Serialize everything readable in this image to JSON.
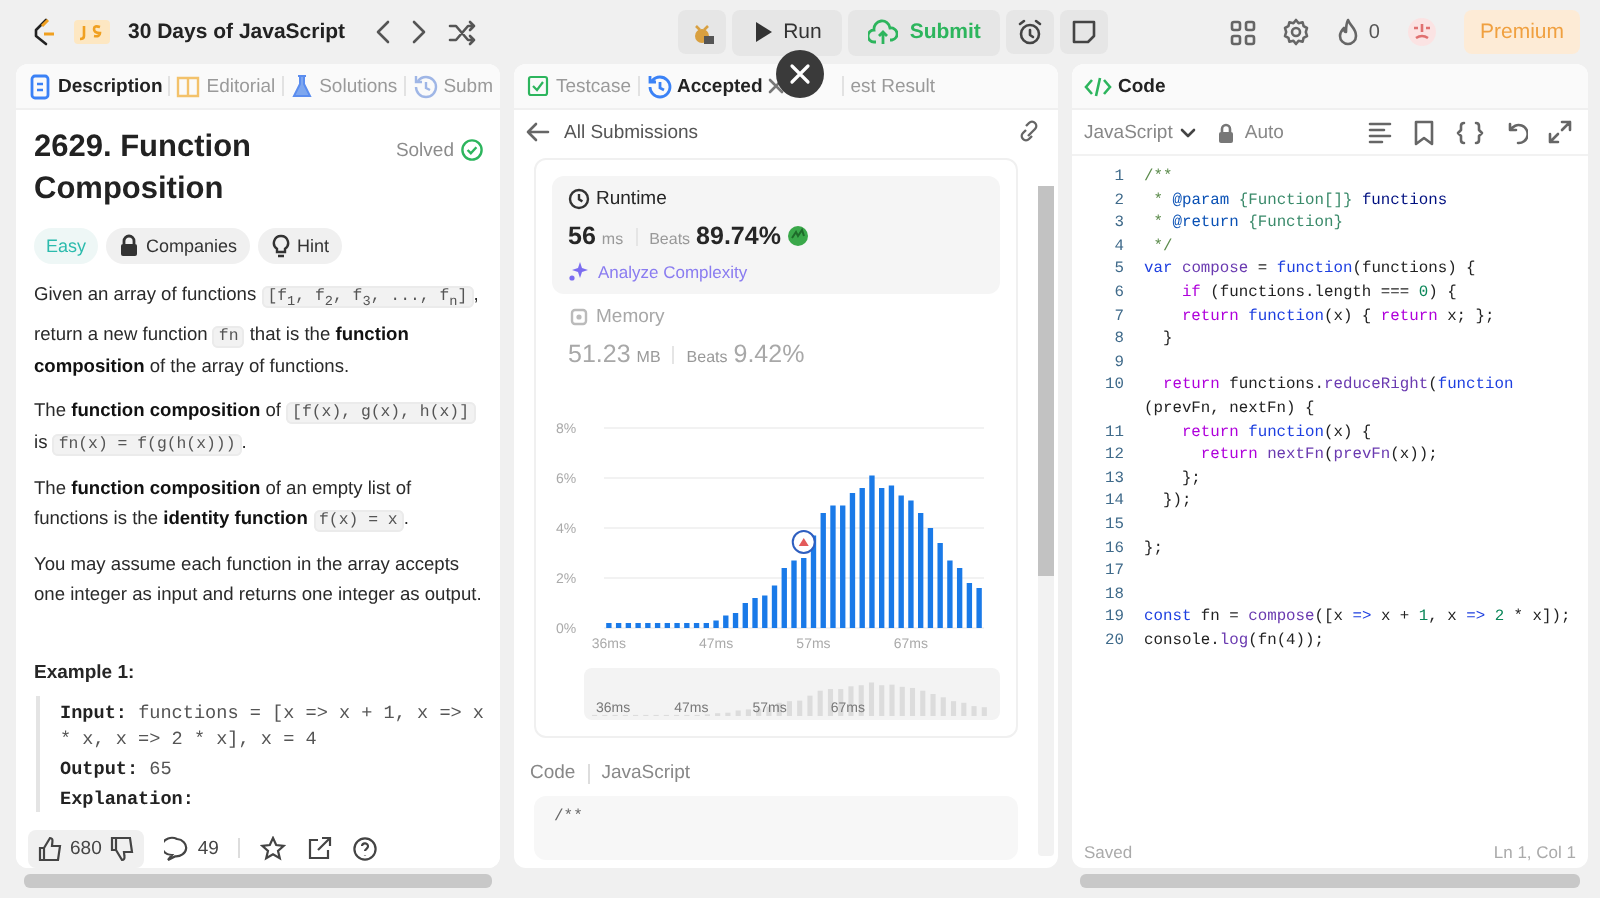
{
  "top_bar": {
    "title": "30 Days of JavaScript",
    "actions": [
      {
        "kind": "run",
        "label": "Run"
      },
      {
        "kind": "submit",
        "label": "Submit"
      }
    ],
    "streak": "0",
    "premium": "Premium"
  },
  "description_panel": {
    "tabs": [
      {
        "label": "Description",
        "selected": true
      },
      {
        "label": "Editorial",
        "selected": false
      },
      {
        "label": "Solutions",
        "selected": false
      },
      {
        "label": "Subm",
        "selected": false
      }
    ],
    "title": "2629. Function Composition",
    "status": "Solved",
    "difficulty": "Easy",
    "tags": [
      "Companies",
      "Hint"
    ],
    "paragraphs": [
      [
        {
          "kind": "text",
          "text": "Given an array of functions "
        },
        {
          "kind": "code",
          "text": "[f$_{1}$, f$_{2}$, f$_{3}$, ..., f$_{n}$]"
        },
        {
          "kind": "text",
          "text": ", return a new function "
        },
        {
          "kind": "code",
          "text": "fn"
        },
        {
          "kind": "text",
          "text": " that is the **function composition** of the array of functions."
        }
      ],
      [
        {
          "kind": "text",
          "text": "The **function composition** of "
        },
        {
          "kind": "code",
          "text": "[f(x), g(x), h(x)]"
        },
        {
          "kind": "text",
          "text": " is "
        },
        {
          "kind": "code",
          "text": "fn(x) = f(g(h(x)))"
        },
        {
          "kind": "text",
          "text": "."
        }
      ],
      [
        {
          "kind": "text",
          "text": "The **function composition** of an empty list of functions is the **identity function** "
        },
        {
          "kind": "code",
          "text": "f(x) = x"
        },
        {
          "kind": "text",
          "text": "."
        }
      ],
      [
        {
          "kind": "text",
          "text": "You may assume each function in the array accepts one integer as input and returns one integer as output."
        }
      ]
    ],
    "example": {
      "heading": "Example 1:",
      "rows": [
        {
          "label": "Input:",
          "value": "functions = [x => x + 1, x => x * x, x => 2 * x], x = 4"
        },
        {
          "label": "Output:",
          "value": "65"
        },
        {
          "label": "Explanation:"
        }
      ]
    },
    "footer": {
      "likes": "680",
      "comments": "49"
    }
  },
  "submission": {
    "tabs": [
      {
        "label": "Testcase",
        "selected": false,
        "closable": false
      },
      {
        "label": "Accepted",
        "selected": true,
        "closable": true
      },
      {
        "label": "est Result",
        "selected": false,
        "closable": false
      }
    ],
    "back_label": "All Submissions",
    "metrics": [
      {
        "title": "Runtime",
        "selected": true,
        "value": "56",
        "unit": "ms",
        "beats_label": "Beats",
        "beats": "89.74%",
        "action": "Analyze Complexity"
      },
      {
        "title": "Memory",
        "selected": false,
        "value": "51.23",
        "unit": "MB",
        "beats_label": "Beats",
        "beats": "9.42%"
      }
    ],
    "chart_data": {
      "type": "bar",
      "x": [
        36,
        37,
        38,
        39,
        40,
        41,
        42,
        43,
        44,
        45,
        46,
        47,
        48,
        49,
        50,
        51,
        52,
        53,
        54,
        55,
        56,
        57,
        58,
        59,
        60,
        61,
        62,
        63,
        64,
        65,
        66,
        67,
        68,
        69,
        70,
        71,
        72,
        73,
        74
      ],
      "values": [
        0.2,
        0.2,
        0.2,
        0.2,
        0.2,
        0.2,
        0.2,
        0.2,
        0.2,
        0.2,
        0.2,
        0.3,
        0.5,
        0.6,
        1.0,
        1.2,
        1.3,
        1.7,
        2.4,
        2.7,
        2.8,
        3.7,
        4.6,
        4.9,
        4.9,
        5.4,
        5.6,
        6.1,
        5.6,
        5.7,
        5.3,
        5.1,
        4.6,
        4.0,
        3.4,
        2.7,
        2.4,
        1.8,
        1.6
      ],
      "xlim": [
        35.5,
        74.5
      ],
      "ylim": [
        0,
        8
      ],
      "grid": true,
      "yticks": [
        {
          "value": 0,
          "label": "0%"
        },
        {
          "value": 2,
          "label": "2%"
        },
        {
          "value": 4,
          "label": "4%"
        },
        {
          "value": 6,
          "label": "6%"
        },
        {
          "value": 8,
          "label": "8%"
        }
      ],
      "xticks": [
        {
          "value": 36,
          "label": "36ms"
        },
        {
          "value": 47,
          "label": "47ms"
        },
        {
          "value": 57,
          "label": "57ms"
        },
        {
          "value": 67,
          "label": "67ms"
        }
      ]
    },
    "overview_labels": [
      "36ms",
      "47ms",
      "57ms",
      "67ms"
    ],
    "code_label": "Code",
    "code_language": "JavaScript",
    "code_preview": "/**"
  },
  "editor": {
    "tab": "Code",
    "language": "JavaScript",
    "mode": "Auto",
    "lines": [
      {
        "number": "1",
        "segments": [
          {
            "kind": "comment",
            "text": "/**"
          }
        ]
      },
      {
        "number": "2",
        "segments": [
          {
            "kind": "comment",
            "text": " * "
          },
          {
            "kind": "tag",
            "text": "@param"
          },
          {
            "kind": "type",
            "text": " {Function[]}"
          },
          {
            "kind": "param",
            "text": " functions"
          }
        ]
      },
      {
        "number": "3",
        "segments": [
          {
            "kind": "comment",
            "text": " * "
          },
          {
            "kind": "tag",
            "text": "@return"
          },
          {
            "kind": "type",
            "text": " {Function}"
          }
        ]
      },
      {
        "number": "4",
        "segments": [
          {
            "kind": "comment",
            "text": " */"
          }
        ]
      },
      {
        "number": "5",
        "segments": [
          {
            "kind": "storage",
            "text": "var "
          },
          {
            "kind": "func",
            "text": "compose"
          },
          {
            "kind": "plain",
            "text": " = "
          },
          {
            "kind": "storage",
            "text": "function"
          },
          {
            "kind": "plain",
            "text": "(functions) {"
          }
        ]
      },
      {
        "number": "6",
        "segments": [
          {
            "kind": "control",
            "text": "    if"
          },
          {
            "kind": "plain",
            "text": " (functions.length === "
          },
          {
            "kind": "number",
            "text": "0"
          },
          {
            "kind": "plain",
            "text": ") {"
          }
        ]
      },
      {
        "number": "7",
        "segments": [
          {
            "kind": "control",
            "text": "    return "
          },
          {
            "kind": "storage",
            "text": "function"
          },
          {
            "kind": "plain",
            "text": "(x) { "
          },
          {
            "kind": "control",
            "text": "return"
          },
          {
            "kind": "plain",
            "text": " x; };"
          }
        ]
      },
      {
        "number": "8",
        "segments": [
          {
            "kind": "plain",
            "text": "  }"
          }
        ]
      },
      {
        "number": "9"
      },
      {
        "number": "10",
        "segments": [
          {
            "kind": "control",
            "text": "  return"
          },
          {
            "kind": "plain",
            "text": " functions."
          },
          {
            "kind": "func",
            "text": "reduceRight"
          },
          {
            "kind": "plain",
            "text": "("
          },
          {
            "kind": "storage",
            "text": "function"
          }
        ],
        "continuation": [
          {
            "kind": "plain",
            "text": "(prevFn, nextFn) {"
          }
        ]
      },
      {
        "number": "11",
        "segments": [
          {
            "kind": "control",
            "text": "    return "
          },
          {
            "kind": "storage",
            "text": "function"
          },
          {
            "kind": "plain",
            "text": "(x) {"
          }
        ]
      },
      {
        "number": "12",
        "segments": [
          {
            "kind": "control",
            "text": "      return "
          },
          {
            "kind": "func",
            "text": "nextFn"
          },
          {
            "kind": "plain",
            "text": "("
          },
          {
            "kind": "func",
            "text": "prevFn"
          },
          {
            "kind": "plain",
            "text": "(x));"
          }
        ]
      },
      {
        "number": "13",
        "segments": [
          {
            "kind": "plain",
            "text": "    };"
          }
        ]
      },
      {
        "number": "14",
        "segments": [
          {
            "kind": "plain",
            "text": "  });"
          }
        ]
      },
      {
        "number": "15"
      },
      {
        "number": "16",
        "segments": [
          {
            "kind": "plain",
            "text": "};"
          }
        ]
      },
      {
        "number": "17"
      },
      {
        "number": "18"
      },
      {
        "number": "19",
        "segments": [
          {
            "kind": "storage",
            "text": "const"
          },
          {
            "kind": "plain",
            "text": " fn = "
          },
          {
            "kind": "func",
            "text": "compose"
          },
          {
            "kind": "plain",
            "text": "([x "
          },
          {
            "kind": "storage",
            "text": "=>"
          },
          {
            "kind": "plain",
            "text": " x + "
          },
          {
            "kind": "number",
            "text": "1"
          },
          {
            "kind": "plain",
            "text": ", x "
          },
          {
            "kind": "storage",
            "text": "=> "
          },
          {
            "kind": "number",
            "text": "2"
          },
          {
            "kind": "plain",
            "text": " * x]);"
          }
        ]
      },
      {
        "number": "20",
        "segments": [
          {
            "kind": "plain",
            "text": "console."
          },
          {
            "kind": "func",
            "text": "log"
          },
          {
            "kind": "plain",
            "text": "(fn(4));"
          }
        ]
      }
    ],
    "status": "Saved",
    "cursor": "Ln 1, Col 1"
  }
}
